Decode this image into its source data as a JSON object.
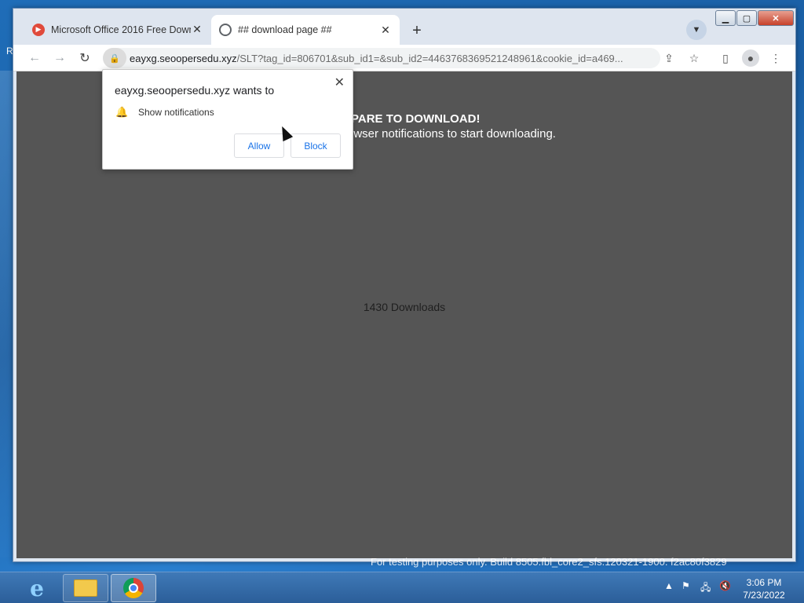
{
  "desktop": {
    "left_glyph": "R"
  },
  "window": {
    "controls": {
      "minimize": "▁",
      "maximize": "▢",
      "close": "✕"
    }
  },
  "tabs": [
    {
      "title": "Microsoft Office 2016 Free Down",
      "icon": "red-play-icon",
      "active": false
    },
    {
      "title": "## download page ##",
      "icon": "globe-icon",
      "active": true
    }
  ],
  "toolbar": {
    "url_domain": "eayxg.seoopersedu.xyz",
    "url_rest": "/SLT?tag_id=806701&sub_id1=&sub_id2=4463768369521248961&cookie_id=a469..."
  },
  "page": {
    "headline": "PARE TO DOWNLOAD!",
    "subline": "owser notifications to start downloading.",
    "downloads": "1430 Downloads"
  },
  "popup": {
    "title": "eayxg.seoopersedu.xyz wants to",
    "description": "Show notifications",
    "allow_label": "Allow",
    "block_label": "Block"
  },
  "watermark": "For testing purposes only. Build 8505.fbl_core2_sfs.120321-1900. f2ac80f3829",
  "taskbar": {
    "clock_time": "3:06 PM",
    "clock_date": "7/23/2022"
  },
  "colors": {
    "page_background": "#555555",
    "popup_button_text": "#1a73e8",
    "taskbar": "#2b5e99"
  }
}
